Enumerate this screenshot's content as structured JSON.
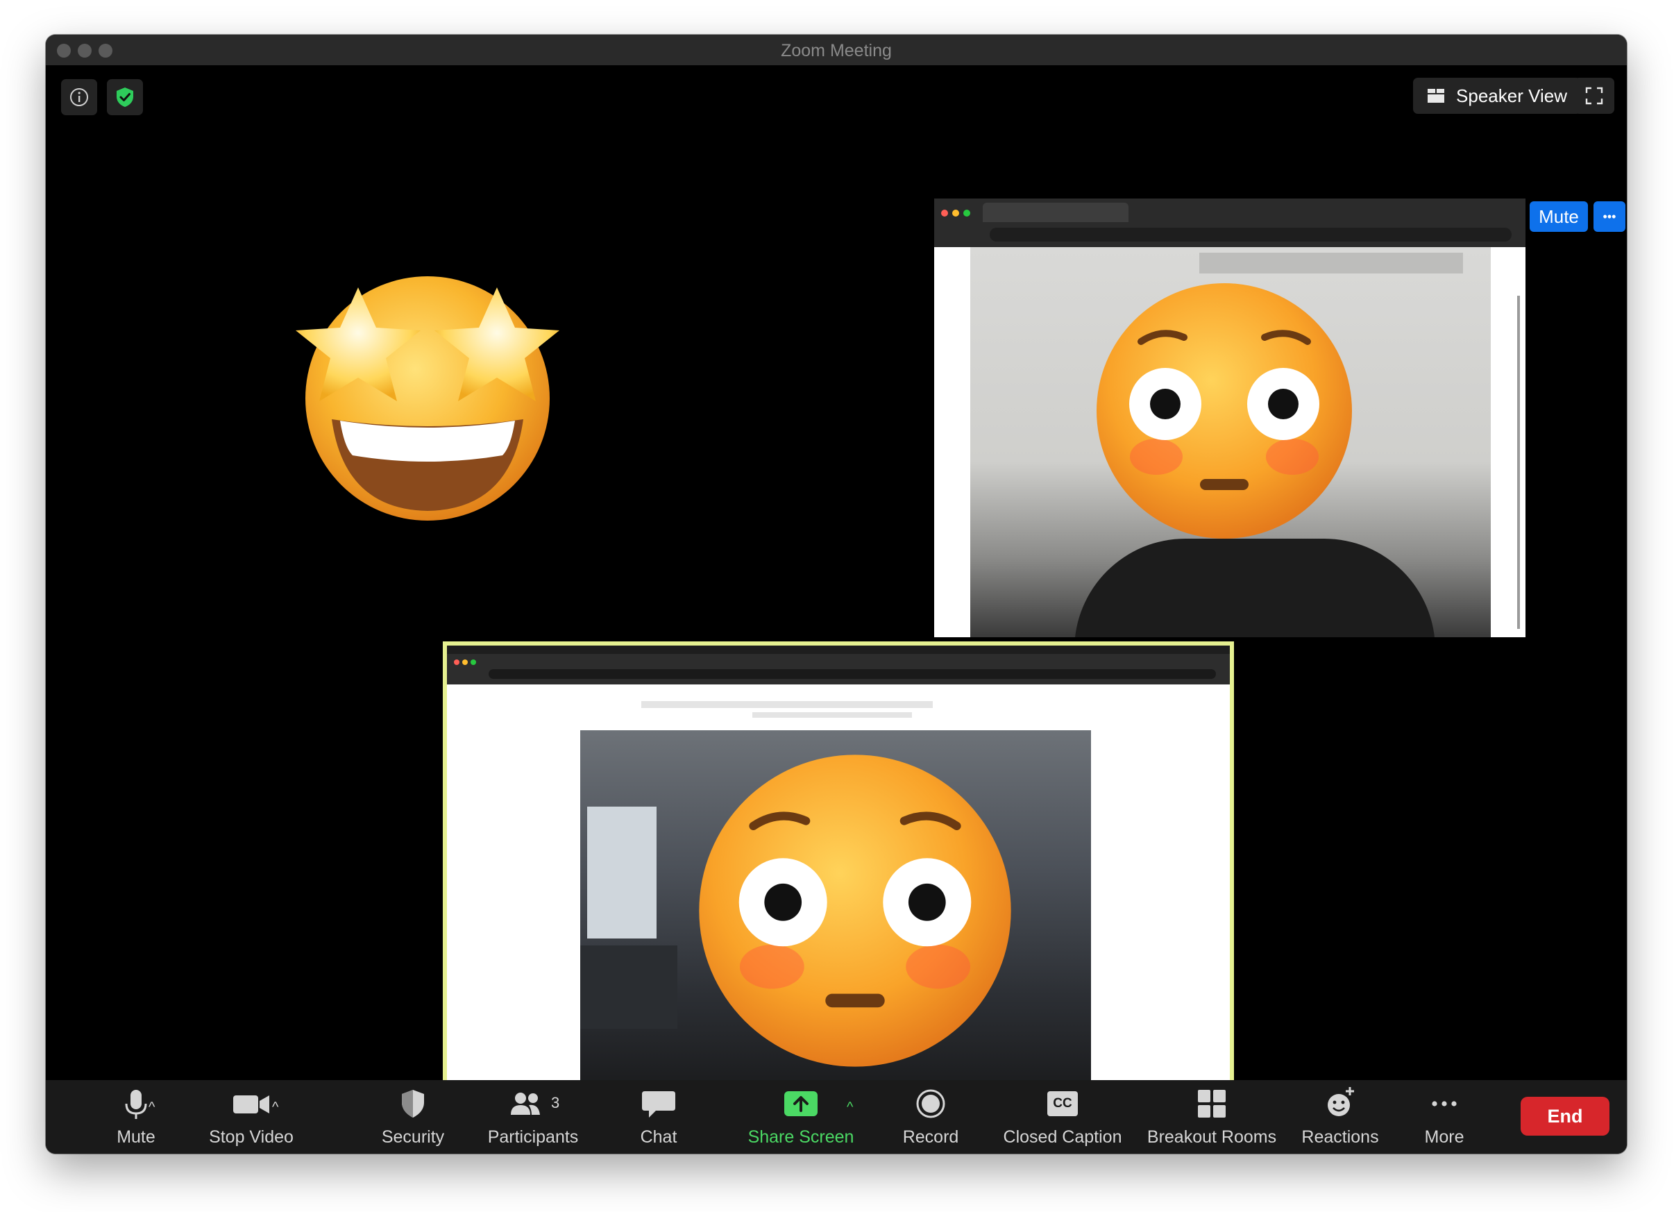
{
  "window": {
    "title": "Zoom Meeting"
  },
  "top_bar": {
    "speaker_view_label": "Speaker View"
  },
  "participant_tile": {
    "mute_label": "Mute",
    "more_label": "•••"
  },
  "toolbar": {
    "mute": "Mute",
    "stop_video": "Stop Video",
    "security": "Security",
    "participants": "Participants",
    "participants_count": "3",
    "chat": "Chat",
    "share_screen": "Share Screen",
    "record": "Record",
    "closed_caption": "Closed Caption",
    "cc_badge": "CC",
    "breakout_rooms": "Breakout Rooms",
    "reactions": "Reactions",
    "more": "More",
    "end": "End"
  },
  "colors": {
    "share_green": "#4bd964",
    "end_red": "#d7262b",
    "zoom_blue": "#0e71eb",
    "active_speaker_border": "#e5f090"
  }
}
